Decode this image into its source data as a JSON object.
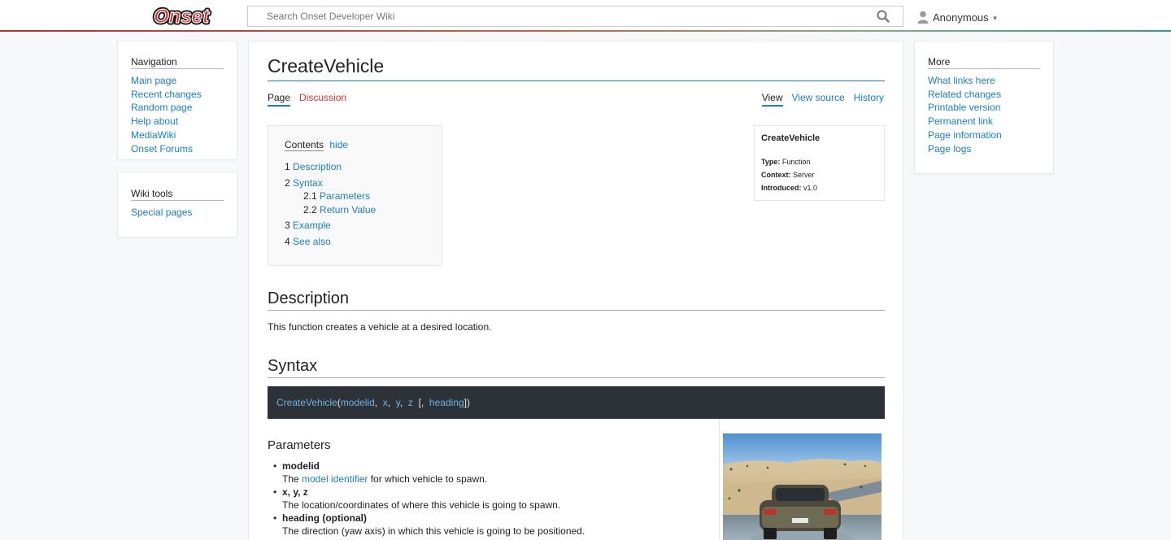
{
  "header": {
    "logo_text": "Onset",
    "search_placeholder": "Search Onset Developer Wiki",
    "user_label": "Anonymous"
  },
  "sidebar": {
    "navigation": {
      "title": "Navigation",
      "items": [
        "Main page",
        "Recent changes",
        "Random page",
        "Help about MediaWiki",
        "Onset Forums"
      ]
    },
    "wiki_tools": {
      "title": "Wiki tools",
      "items": [
        "Special pages"
      ]
    }
  },
  "more": {
    "title": "More",
    "items": [
      "What links here",
      "Related changes",
      "Printable version",
      "Permanent link",
      "Page information",
      "Page logs"
    ]
  },
  "page": {
    "title": "CreateVehicle",
    "tabs_left": [
      "Page",
      "Discussion"
    ],
    "tabs_right": [
      "View",
      "View source",
      "History"
    ]
  },
  "toc": {
    "title": "Contents",
    "hide": "hide",
    "items": [
      {
        "num": "1",
        "label": "Description"
      },
      {
        "num": "2",
        "label": "Syntax"
      },
      {
        "num": "2.1",
        "label": "Parameters"
      },
      {
        "num": "2.2",
        "label": "Return Value"
      },
      {
        "num": "3",
        "label": "Example"
      },
      {
        "num": "4",
        "label": "See also"
      }
    ]
  },
  "infobox": {
    "title": "CreateVehicle",
    "rows": [
      {
        "key": "Type:",
        "value": "Function"
      },
      {
        "key": "Context:",
        "value": "Server"
      },
      {
        "key": "Introduced:",
        "value": "v1.0"
      }
    ]
  },
  "description": {
    "heading": "Description",
    "text": "This function creates a vehicle at a desired location."
  },
  "syntax": {
    "heading": "Syntax",
    "code": {
      "fn": "CreateVehicle",
      "open": "(",
      "args": [
        "modelid",
        "x",
        "y",
        "z"
      ],
      "optional_open": "[,",
      "optional_arg": "heading",
      "close": "])"
    }
  },
  "parameters": {
    "heading": "Parameters",
    "items": [
      {
        "name": "modelid",
        "desc_pre": "The ",
        "desc_link": "model identifier",
        "desc_post": " for which vehicle to spawn."
      },
      {
        "name": "x, y, z",
        "desc_pre": "The location/coordinates of where this vehicle is going to spawn.",
        "desc_link": "",
        "desc_post": ""
      },
      {
        "name": "heading (optional)",
        "desc_pre": "The direction (yaw axis) in which this vehicle is going to be positioned.",
        "desc_link": "",
        "desc_post": ""
      }
    ]
  },
  "colors": {
    "link": "#1a7fc6",
    "discussion_red": "#d33",
    "code_bg": "#2d3138",
    "logo_red": "#d72b2b"
  }
}
